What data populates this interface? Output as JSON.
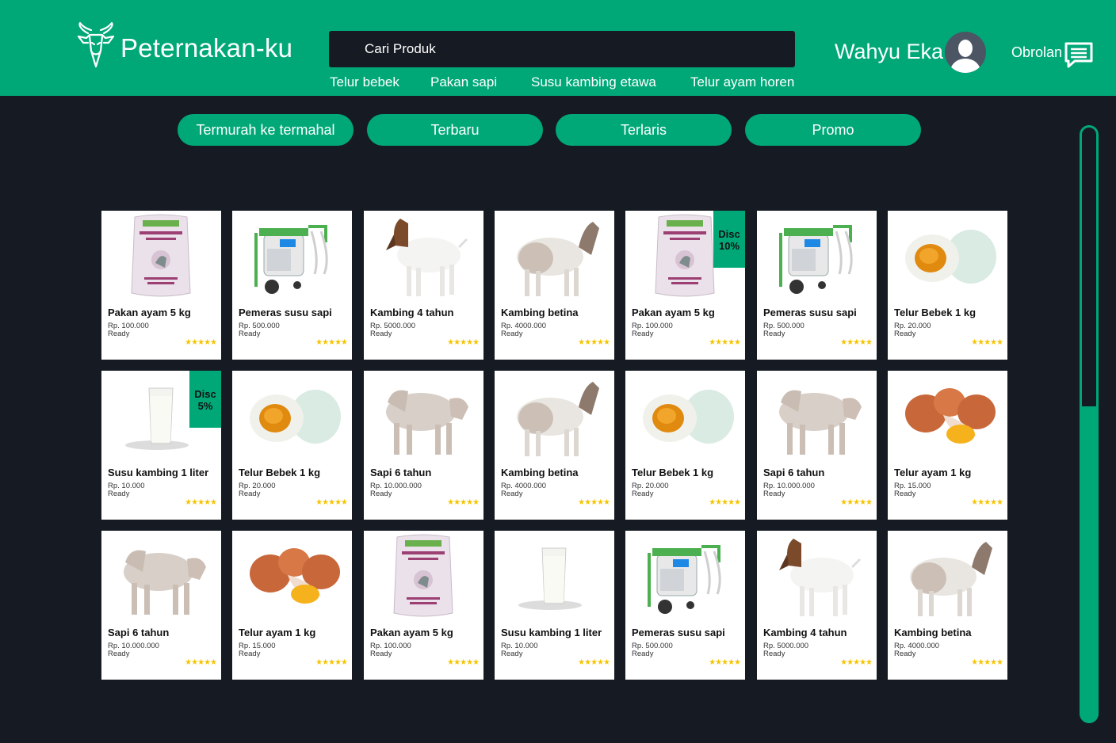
{
  "app": {
    "title": "Peternakan-ku",
    "accent": "#00a878",
    "background": "#161a22"
  },
  "search": {
    "placeholder": "Cari Produk"
  },
  "quick_links": [
    "Telur bebek",
    "Pakan sapi",
    "Susu kambing etawa",
    "Telur ayam horen"
  ],
  "user": {
    "name": "Wahyu Eka",
    "avatar_icon": "user-avatar-icon"
  },
  "chat": {
    "label": "Obrolan",
    "icon": "chat-bubble-icon"
  },
  "filters": [
    "Termurah ke termahal",
    "Terbaru",
    "Terlaris",
    "Promo"
  ],
  "rating_stars": "★★★★★",
  "products": [
    {
      "name": "Pakan ayam 5 kg",
      "price": "Rp. 100.000",
      "status": "Ready",
      "image": "feed-sack-icon"
    },
    {
      "name": "Pemeras susu sapi",
      "price": "Rp. 500.000",
      "status": "Ready",
      "image": "milking-machine-icon"
    },
    {
      "name": "Kambing 4 tahun",
      "price": "Rp. 5000.000",
      "status": "Ready",
      "image": "goat-brown-head-icon"
    },
    {
      "name": "Kambing betina",
      "price": "Rp. 4000.000",
      "status": "Ready",
      "image": "goat-female-icon"
    },
    {
      "name": "Pakan ayam 5 kg",
      "price": "Rp. 100.000",
      "status": "Ready",
      "image": "feed-sack-icon",
      "discount": "Disc 10%"
    },
    {
      "name": "Pemeras susu sapi",
      "price": "Rp. 500.000",
      "status": "Ready",
      "image": "milking-machine-icon"
    },
    {
      "name": "Telur Bebek 1 kg",
      "price": "Rp. 20.000",
      "status": "Ready",
      "image": "duck-egg-icon"
    },
    {
      "name": "Susu kambing 1 liter",
      "price": "Rp. 10.000",
      "status": "Ready",
      "image": "milk-glass-icon",
      "discount": "Disc 5%"
    },
    {
      "name": "Telur Bebek 1 kg",
      "price": "Rp. 20.000",
      "status": "Ready",
      "image": "duck-egg-icon"
    },
    {
      "name": "Sapi 6 tahun",
      "price": "Rp. 10.000.000",
      "status": "Ready",
      "image": "cow-icon"
    },
    {
      "name": "Kambing betina",
      "price": "Rp. 4000.000",
      "status": "Ready",
      "image": "goat-female-icon"
    },
    {
      "name": "Telur Bebek 1 kg",
      "price": "Rp. 20.000",
      "status": "Ready",
      "image": "duck-egg-icon"
    },
    {
      "name": "Sapi 6 tahun",
      "price": "Rp. 10.000.000",
      "status": "Ready",
      "image": "cow-icon"
    },
    {
      "name": "Telur ayam 1 kg",
      "price": "Rp. 15.000",
      "status": "Ready",
      "image": "chicken-egg-icon"
    },
    {
      "name": "Sapi 6 tahun",
      "price": "Rp. 10.000.000",
      "status": "Ready",
      "image": "cow-icon"
    },
    {
      "name": "Telur ayam 1 kg",
      "price": "Rp. 15.000",
      "status": "Ready",
      "image": "chicken-egg-icon"
    },
    {
      "name": "Pakan ayam 5 kg",
      "price": "Rp. 100.000",
      "status": "Ready",
      "image": "feed-sack-icon"
    },
    {
      "name": "Susu kambing 1 liter",
      "price": "Rp. 10.000",
      "status": "Ready",
      "image": "milk-glass-icon"
    },
    {
      "name": "Pemeras susu sapi",
      "price": "Rp. 500.000",
      "status": "Ready",
      "image": "milking-machine-icon"
    },
    {
      "name": "Kambing 4 tahun",
      "price": "Rp. 5000.000",
      "status": "Ready",
      "image": "goat-brown-head-icon"
    },
    {
      "name": "Kambing betina",
      "price": "Rp. 4000.000",
      "status": "Ready",
      "image": "goat-female-icon"
    }
  ]
}
